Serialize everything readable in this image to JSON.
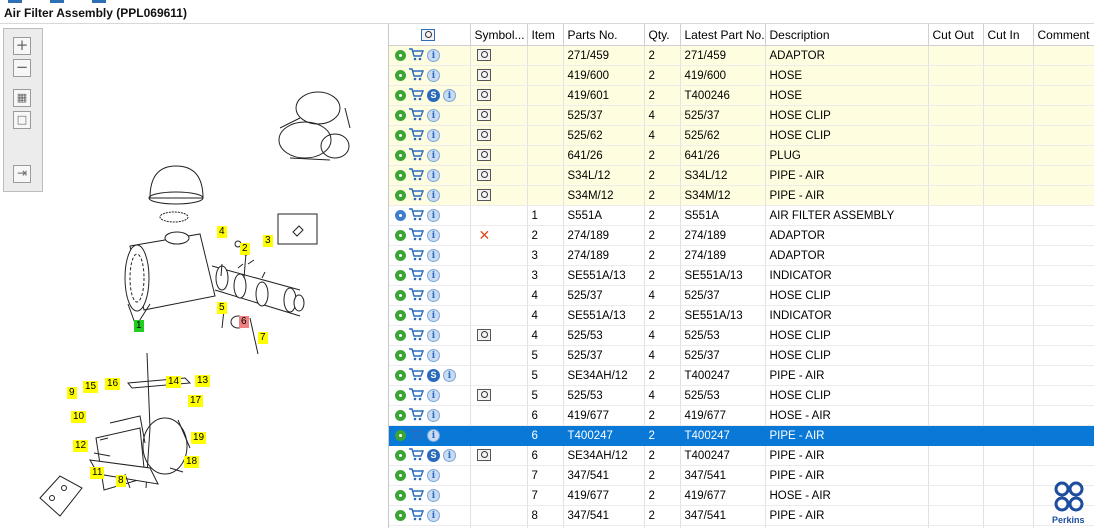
{
  "title": "Air Filter Assembly (PPL069611)",
  "toolbar": {
    "zoom_in": "+",
    "zoom_out": "−",
    "fit": "▦",
    "actual": "□",
    "export": "⇥"
  },
  "callouts": [
    {
      "text": "1",
      "style": "green"
    },
    {
      "text": "2"
    },
    {
      "text": "3"
    },
    {
      "text": "4"
    },
    {
      "text": "5"
    },
    {
      "text": "6",
      "style": "red"
    },
    {
      "text": "7"
    },
    {
      "text": "8"
    },
    {
      "text": "9"
    },
    {
      "text": "10"
    },
    {
      "text": "11"
    },
    {
      "text": "12"
    },
    {
      "text": "13"
    },
    {
      "text": "14"
    },
    {
      "text": "15"
    },
    {
      "text": "16"
    },
    {
      "text": "17"
    },
    {
      "text": "18"
    },
    {
      "text": "19"
    }
  ],
  "grid": {
    "columns": [
      "",
      "Symbol...",
      "Item",
      "Parts No.",
      "Qty.",
      "Latest Part No.",
      "Description",
      "Cut Out",
      "Cut In",
      "Comment"
    ],
    "rows": [
      {
        "icons": [
          "gear",
          "cart",
          "i"
        ],
        "symbol": "mag",
        "item": "",
        "part": "271/459",
        "qty": "2",
        "latest": "271/459",
        "desc": "ADAPTOR",
        "style": "yellow"
      },
      {
        "icons": [
          "gear",
          "cart",
          "i"
        ],
        "symbol": "mag",
        "item": "",
        "part": "419/600",
        "qty": "2",
        "latest": "419/600",
        "desc": "HOSE",
        "style": "yellow"
      },
      {
        "icons": [
          "gear",
          "cart",
          "s",
          "i"
        ],
        "symbol": "mag",
        "item": "",
        "part": "419/601",
        "qty": "2",
        "latest": "T400246",
        "desc": "HOSE",
        "style": "yellow"
      },
      {
        "icons": [
          "gear",
          "cart",
          "i"
        ],
        "symbol": "mag",
        "item": "",
        "part": "525/37",
        "qty": "4",
        "latest": "525/37",
        "desc": "HOSE CLIP",
        "style": "yellow"
      },
      {
        "icons": [
          "gear",
          "cart",
          "i"
        ],
        "symbol": "mag",
        "item": "",
        "part": "525/62",
        "qty": "4",
        "latest": "525/62",
        "desc": "HOSE CLIP",
        "style": "yellow"
      },
      {
        "icons": [
          "gear",
          "cart",
          "i"
        ],
        "symbol": "mag",
        "item": "",
        "part": "641/26",
        "qty": "2",
        "latest": "641/26",
        "desc": "PLUG",
        "style": "yellow"
      },
      {
        "icons": [
          "gear",
          "cart",
          "i"
        ],
        "symbol": "mag",
        "item": "",
        "part": "S34L/12",
        "qty": "2",
        "latest": "S34L/12",
        "desc": "PIPE - AIR",
        "style": "yellow"
      },
      {
        "icons": [
          "gear",
          "cart",
          "i"
        ],
        "symbol": "mag",
        "item": "",
        "part": "S34M/12",
        "qty": "2",
        "latest": "S34M/12",
        "desc": "PIPE - AIR",
        "style": "yellow"
      },
      {
        "icons": [
          "gearblue",
          "cart",
          "i"
        ],
        "symbol": "",
        "item": "1",
        "part": "S551A",
        "qty": "2",
        "latest": "S551A",
        "desc": "AIR FILTER ASSEMBLY",
        "style": ""
      },
      {
        "icons": [
          "gear",
          "cart",
          "i"
        ],
        "symbol": "x",
        "item": "2",
        "part": "274/189",
        "qty": "2",
        "latest": "274/189",
        "desc": "ADAPTOR",
        "style": ""
      },
      {
        "icons": [
          "gear",
          "cart",
          "i"
        ],
        "symbol": "",
        "item": "3",
        "part": "274/189",
        "qty": "2",
        "latest": "274/189",
        "desc": "ADAPTOR",
        "style": ""
      },
      {
        "icons": [
          "gear",
          "cart",
          "i"
        ],
        "symbol": "",
        "item": "3",
        "part": "SE551A/13",
        "qty": "2",
        "latest": "SE551A/13",
        "desc": "INDICATOR",
        "style": ""
      },
      {
        "icons": [
          "gear",
          "cart",
          "i"
        ],
        "symbol": "",
        "item": "4",
        "part": "525/37",
        "qty": "4",
        "latest": "525/37",
        "desc": "HOSE CLIP",
        "style": ""
      },
      {
        "icons": [
          "gear",
          "cart",
          "i"
        ],
        "symbol": "",
        "item": "4",
        "part": "SE551A/13",
        "qty": "2",
        "latest": "SE551A/13",
        "desc": "INDICATOR",
        "style": ""
      },
      {
        "icons": [
          "gear",
          "cart",
          "i"
        ],
        "symbol": "mag",
        "item": "4",
        "part": "525/53",
        "qty": "4",
        "latest": "525/53",
        "desc": "HOSE CLIP",
        "style": ""
      },
      {
        "icons": [
          "gear",
          "cart",
          "i"
        ],
        "symbol": "",
        "item": "5",
        "part": "525/37",
        "qty": "4",
        "latest": "525/37",
        "desc": "HOSE CLIP",
        "style": ""
      },
      {
        "icons": [
          "gear",
          "cart",
          "s",
          "i"
        ],
        "symbol": "",
        "item": "5",
        "part": "SE34AH/12",
        "qty": "2",
        "latest": "T400247",
        "desc": "PIPE - AIR",
        "style": ""
      },
      {
        "icons": [
          "gear",
          "cart",
          "i"
        ],
        "symbol": "mag",
        "item": "5",
        "part": "525/53",
        "qty": "4",
        "latest": "525/53",
        "desc": "HOSE CLIP",
        "style": ""
      },
      {
        "icons": [
          "gear",
          "cart",
          "i"
        ],
        "symbol": "",
        "item": "6",
        "part": "419/677",
        "qty": "2",
        "latest": "419/677",
        "desc": "HOSE - AIR",
        "style": ""
      },
      {
        "icons": [
          "gear",
          "cart",
          "i"
        ],
        "symbol": "",
        "item": "6",
        "part": "T400247",
        "qty": "2",
        "latest": "T400247",
        "desc": "PIPE - AIR",
        "style": "sel"
      },
      {
        "icons": [
          "gear",
          "cart",
          "s",
          "i"
        ],
        "symbol": "mag",
        "item": "6",
        "part": "SE34AH/12",
        "qty": "2",
        "latest": "T400247",
        "desc": "PIPE - AIR",
        "style": ""
      },
      {
        "icons": [
          "gear",
          "cart",
          "i"
        ],
        "symbol": "",
        "item": "7",
        "part": "347/541",
        "qty": "2",
        "latest": "347/541",
        "desc": "PIPE - AIR",
        "style": ""
      },
      {
        "icons": [
          "gear",
          "cart",
          "i"
        ],
        "symbol": "",
        "item": "7",
        "part": "419/677",
        "qty": "2",
        "latest": "419/677",
        "desc": "HOSE - AIR",
        "style": ""
      },
      {
        "icons": [
          "gear",
          "cart",
          "i"
        ],
        "symbol": "",
        "item": "8",
        "part": "347/541",
        "qty": "2",
        "latest": "347/541",
        "desc": "PIPE - AIR",
        "style": ""
      },
      {
        "icons": [
          "gear",
          "cart",
          "i"
        ],
        "symbol": "",
        "item": "",
        "part": "",
        "qty": "",
        "latest": "",
        "desc": "",
        "style": ""
      }
    ]
  },
  "brand": {
    "name": "Perkins",
    "color": "#1d4e9e"
  },
  "colors": {
    "selection": "#0a78d7",
    "highlight_row": "#fffde0",
    "callout": "#ffff00"
  }
}
